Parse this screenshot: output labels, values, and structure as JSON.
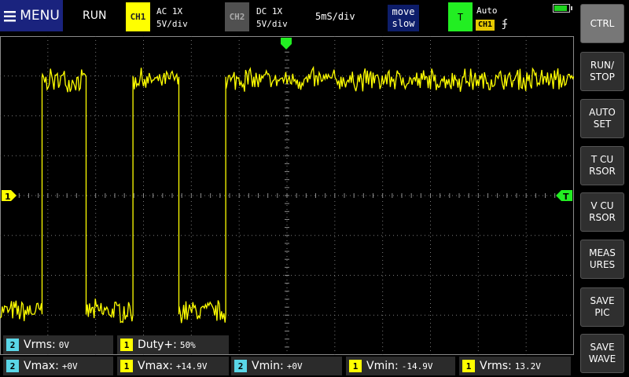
{
  "header": {
    "menu_label": "MENU",
    "run_state": "RUN",
    "ch1": {
      "tag": "CH1",
      "coupling": "AC 1X",
      "scale": "5V/div"
    },
    "ch2": {
      "tag": "CH2",
      "coupling": "DC 1X",
      "scale": "5V/div"
    },
    "timebase": "5mS/div",
    "move": {
      "line1": "move",
      "line2": "slow"
    },
    "trigger": {
      "tag": "T",
      "mode": "Auto",
      "source": "CH1",
      "edge": "ʄ"
    },
    "battery_level": 0.9
  },
  "side_buttons": [
    {
      "label": "CTRL",
      "active": true
    },
    {
      "label": "RUN/\nSTOP"
    },
    {
      "label": "AUTO\nSET"
    },
    {
      "label": "T CU\nRSOR"
    },
    {
      "label": "V CU\nRSOR"
    },
    {
      "label": "MEAS\nURES"
    },
    {
      "label": "SAVE\nPIC"
    },
    {
      "label": "SAVE\nWAVE"
    }
  ],
  "markers": {
    "ch1": "1",
    "trigger_level": "T",
    "trigger_pos": ""
  },
  "measurements": [
    {
      "ch": "2",
      "label": "Vrms",
      "value": "0V"
    },
    {
      "ch": "1",
      "label": "Duty+",
      "value": "50%"
    },
    {
      "ch": "2",
      "label": "Vmax",
      "value": "+0V"
    },
    {
      "ch": "1",
      "label": "Vmax",
      "value": "+14.9V"
    },
    {
      "ch": "2",
      "label": "Vmin",
      "value": "+0V"
    },
    {
      "ch": "1",
      "label": "Vmin",
      "value": "-14.9V"
    },
    {
      "ch": "1",
      "label": "Vrms",
      "value": "13.2V"
    }
  ],
  "colors": {
    "ch1": "#ffff00",
    "ch2": "#5ad7e8",
    "trigger": "#22ee22",
    "menu": "#1a237e"
  },
  "chart_data": {
    "type": "line",
    "series": [
      {
        "name": "CH1",
        "shape": "square",
        "high_v": 14.9,
        "low_v": -14.9,
        "duty_percent": 50,
        "edges_ms": [
          4.4,
          9.0,
          13.9,
          18.7,
          23.6
        ],
        "start_level": "low"
      }
    ],
    "x_divisions": 12,
    "y_divisions": 8,
    "volts_per_div": 5,
    "time_per_div_ms": 5,
    "grid": true
  }
}
